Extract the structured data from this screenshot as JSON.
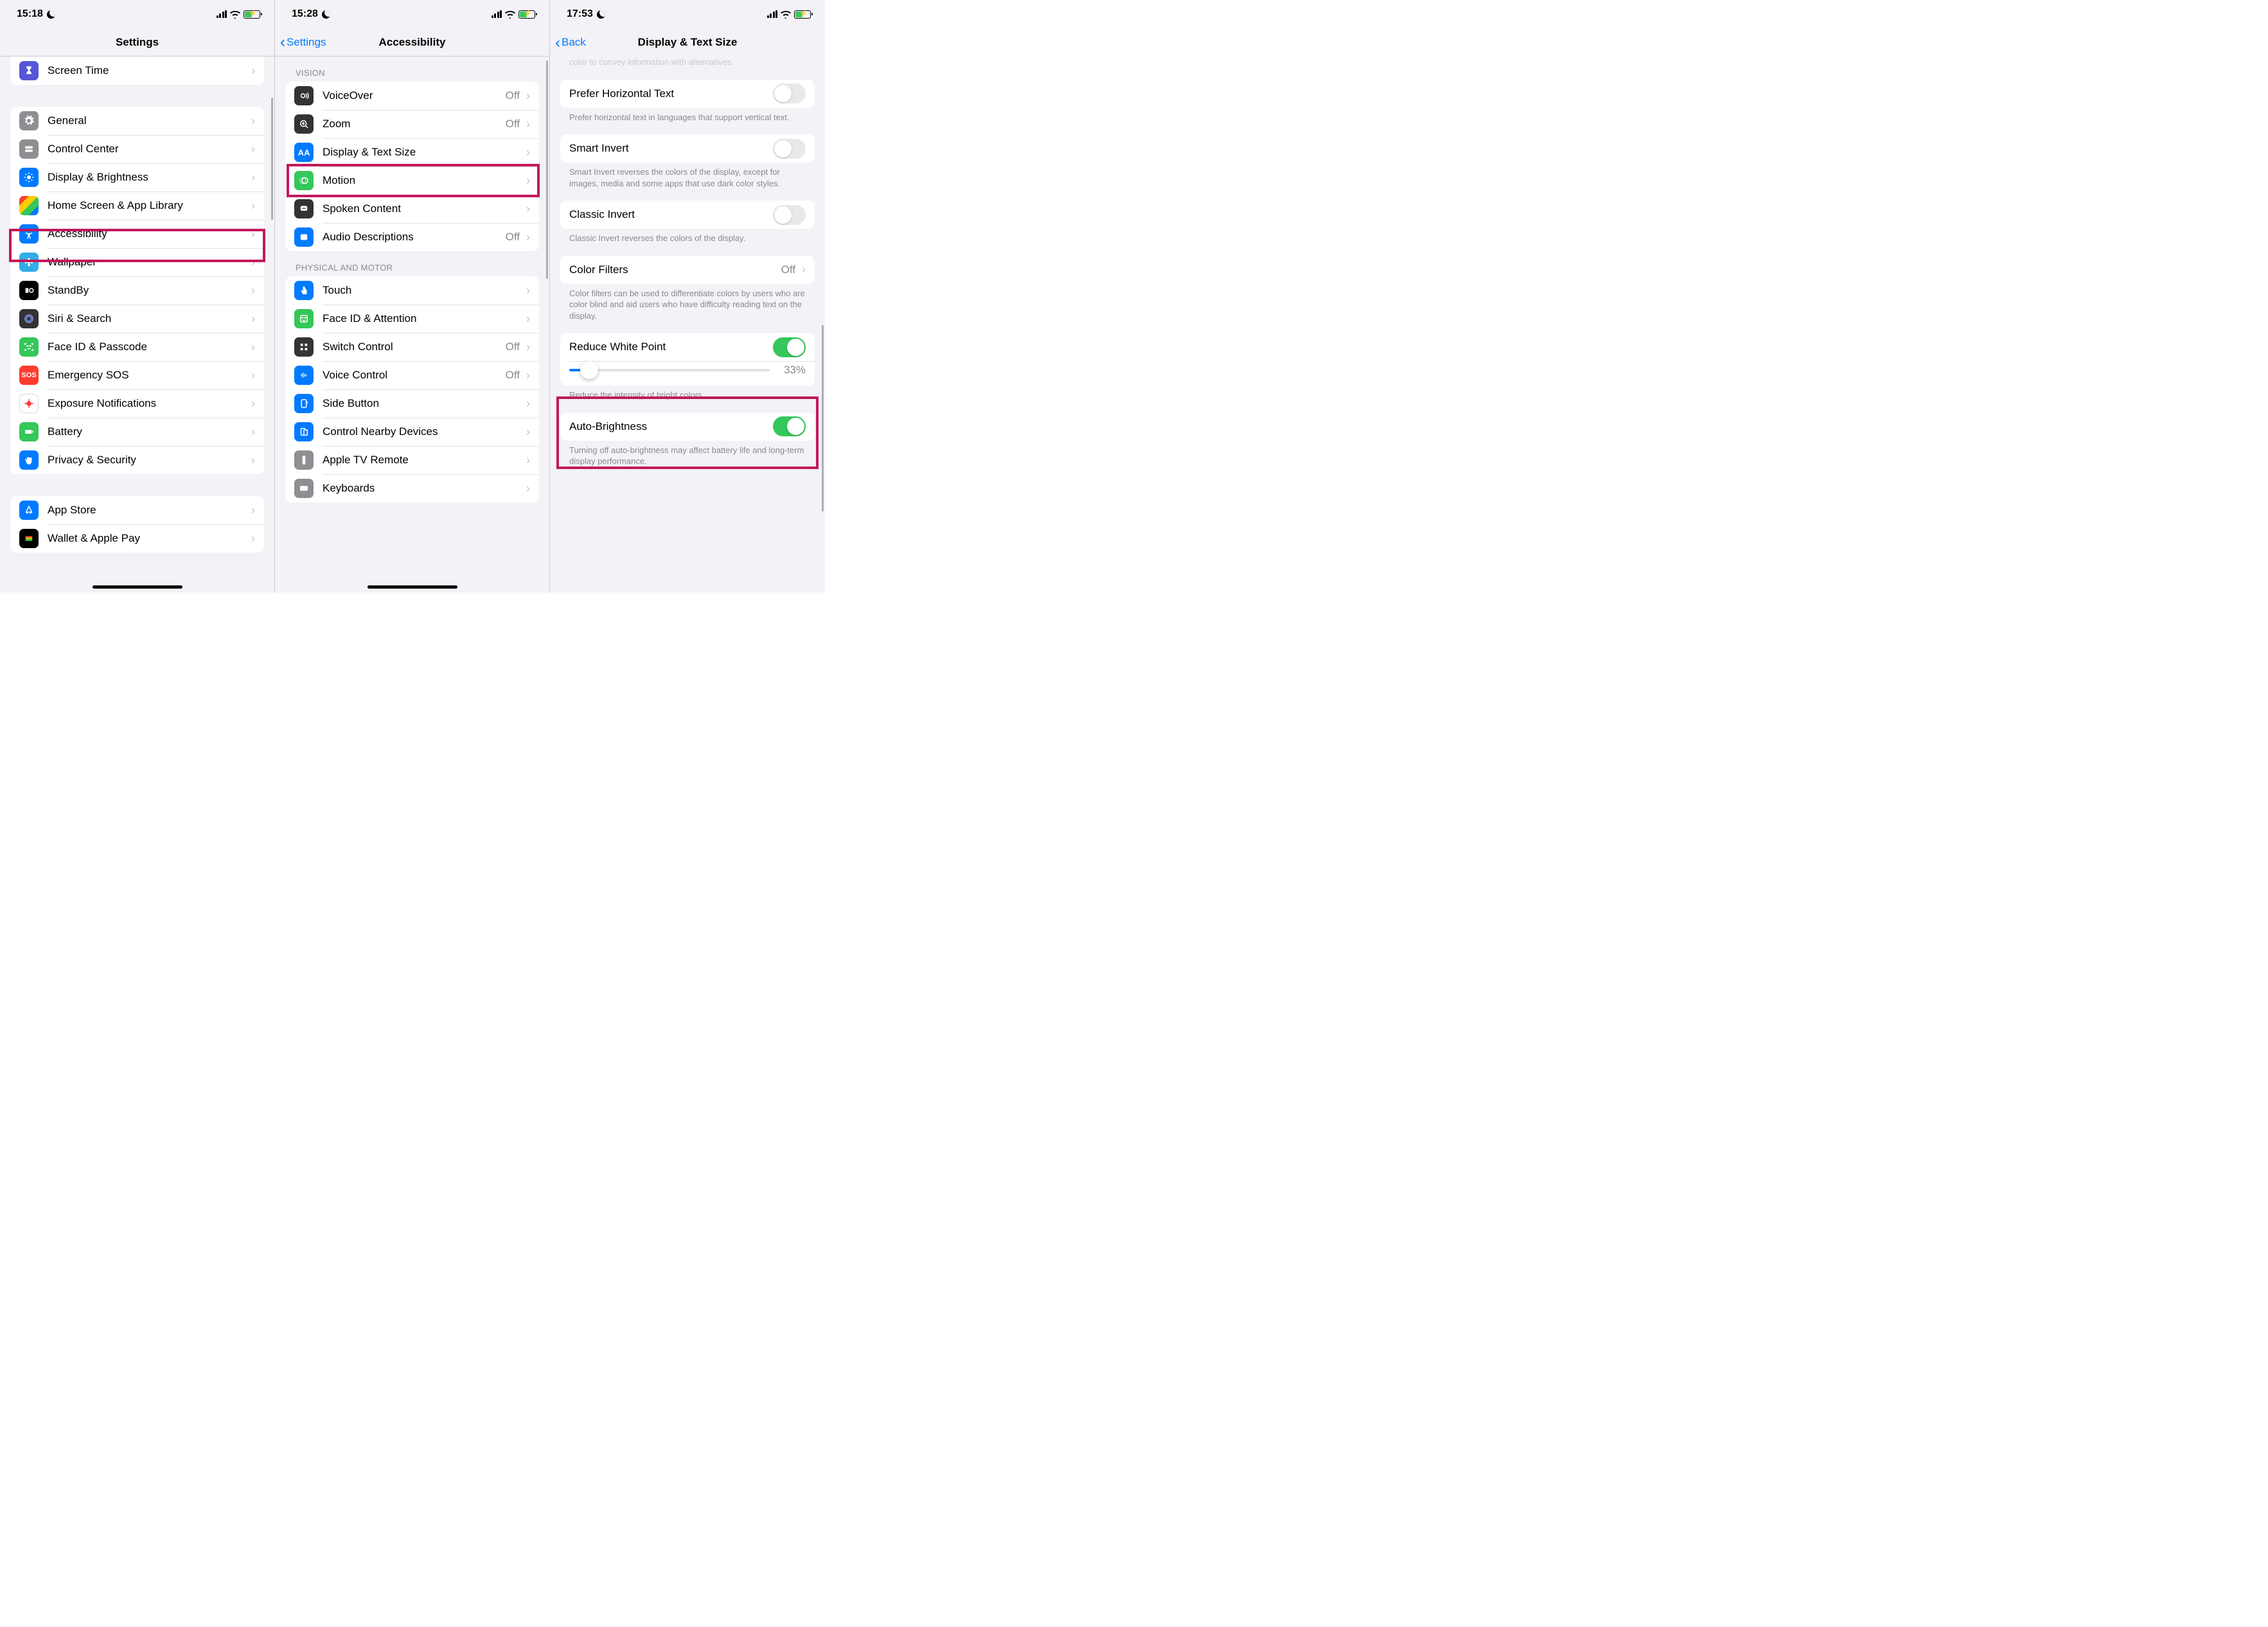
{
  "screens": [
    {
      "status_time": "15:18",
      "nav_title": "Settings",
      "groups": [
        {
          "header": null,
          "partial_top": true,
          "rows": [
            {
              "icon": "hourglass-icon",
              "icon_bg": "bg-purple",
              "label": "Screen Time"
            }
          ]
        },
        {
          "header": null,
          "rows": [
            {
              "icon": "gear-icon",
              "icon_bg": "bg-gray",
              "label": "General"
            },
            {
              "icon": "toggles-icon",
              "icon_bg": "bg-gray",
              "label": "Control Center"
            },
            {
              "icon": "brightness-icon",
              "icon_bg": "bg-blue",
              "label": "Display & Brightness"
            },
            {
              "icon": "grid-icon",
              "icon_bg": "bg-multi",
              "label": "Home Screen & App Library"
            },
            {
              "icon": "accessibility-icon",
              "icon_bg": "bg-blue",
              "label": "Accessibility",
              "highlight": true
            },
            {
              "icon": "flower-icon",
              "icon_bg": "bg-cyan",
              "label": "Wallpaper"
            },
            {
              "icon": "standby-icon",
              "icon_bg": "bg-black",
              "label": "StandBy"
            },
            {
              "icon": "siri-icon",
              "icon_bg": "bg-dark",
              "label": "Siri & Search"
            },
            {
              "icon": "faceid-icon",
              "icon_bg": "bg-green",
              "label": "Face ID & Passcode"
            },
            {
              "icon": "sos-icon",
              "icon_bg": "bg-sos",
              "label": "Emergency SOS"
            },
            {
              "icon": "virus-icon",
              "icon_bg": "bg-white",
              "label": "Exposure Notifications"
            },
            {
              "icon": "battery-icon",
              "icon_bg": "bg-green",
              "label": "Battery"
            },
            {
              "icon": "hand-icon",
              "icon_bg": "bg-blue",
              "label": "Privacy & Security"
            }
          ]
        },
        {
          "header": null,
          "rows": [
            {
              "icon": "appstore-icon",
              "icon_bg": "bg-blue",
              "label": "App Store"
            },
            {
              "icon": "wallet-icon",
              "icon_bg": "bg-black",
              "label": "Wallet & Apple Pay"
            }
          ]
        }
      ]
    },
    {
      "status_time": "15:28",
      "back_label": "Settings",
      "nav_title": "Accessibility",
      "groups": [
        {
          "header": "VISION",
          "rows": [
            {
              "icon": "voiceover-icon",
              "icon_bg": "bg-dark",
              "label": "VoiceOver",
              "value": "Off"
            },
            {
              "icon": "zoom-icon",
              "icon_bg": "bg-dark",
              "label": "Zoom",
              "value": "Off"
            },
            {
              "icon": "textsize-icon",
              "icon_bg": "bg-blue",
              "label": "Display & Text Size",
              "highlight": true
            },
            {
              "icon": "motion-icon",
              "icon_bg": "bg-green",
              "label": "Motion"
            },
            {
              "icon": "spoken-icon",
              "icon_bg": "bg-dark",
              "label": "Spoken Content"
            },
            {
              "icon": "ad-icon",
              "icon_bg": "bg-blue",
              "label": "Audio Descriptions",
              "value": "Off"
            }
          ]
        },
        {
          "header": "PHYSICAL AND MOTOR",
          "rows": [
            {
              "icon": "touch-icon",
              "icon_bg": "bg-blue",
              "label": "Touch"
            },
            {
              "icon": "face-icon",
              "icon_bg": "bg-green",
              "label": "Face ID & Attention"
            },
            {
              "icon": "switch-icon",
              "icon_bg": "bg-dark",
              "label": "Switch Control",
              "value": "Off"
            },
            {
              "icon": "voice-icon",
              "icon_bg": "bg-blue",
              "label": "Voice Control",
              "value": "Off"
            },
            {
              "icon": "sidebutton-icon",
              "icon_bg": "bg-blue",
              "label": "Side Button"
            },
            {
              "icon": "nearby-icon",
              "icon_bg": "bg-blue",
              "label": "Control Nearby Devices"
            },
            {
              "icon": "remote-icon",
              "icon_bg": "bg-gray",
              "label": "Apple TV Remote"
            },
            {
              "icon": "keyboard-icon",
              "icon_bg": "bg-gray",
              "label": "Keyboards"
            }
          ]
        }
      ]
    },
    {
      "status_time": "17:53",
      "back_label": "Back",
      "nav_title": "Display & Text Size",
      "truncated_top_text": "color to convey information with alternatives.",
      "sections": [
        {
          "rows": [
            {
              "label": "Prefer Horizontal Text",
              "toggle": false
            }
          ],
          "footer": "Prefer horizontal text in languages that support vertical text."
        },
        {
          "rows": [
            {
              "label": "Smart Invert",
              "toggle": false
            }
          ],
          "footer": "Smart Invert reverses the colors of the display, except for images, media and some apps that use dark color styles."
        },
        {
          "rows": [
            {
              "label": "Classic Invert",
              "toggle": false
            }
          ],
          "footer": "Classic Invert reverses the colors of the display."
        },
        {
          "rows": [
            {
              "label": "Color Filters",
              "value": "Off",
              "chevron": true
            }
          ],
          "footer": "Color filters can be used to differentiate colors by users who are color blind and aid users who have difficulty reading text on the display."
        },
        {
          "highlight": true,
          "rows": [
            {
              "label": "Reduce White Point",
              "toggle": true
            }
          ],
          "slider": {
            "percent": 33,
            "label": "33%",
            "fill": 10
          },
          "footer": "Reduce the intensity of bright colors."
        },
        {
          "rows": [
            {
              "label": "Auto-Brightness",
              "toggle": true
            }
          ],
          "footer": "Turning off auto-brightness may affect battery life and long-term display performance."
        }
      ]
    }
  ]
}
